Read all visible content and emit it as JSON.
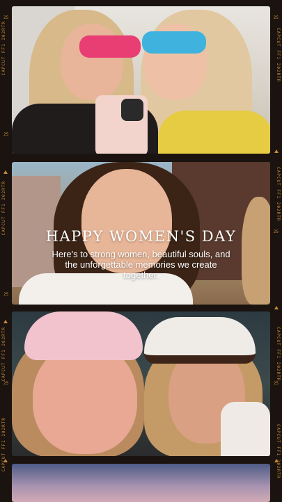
{
  "overlay": {
    "title": "HAPPY WOMEN'S DAY",
    "subtitle": "Here's to strong women, beautiful souls, and the unforgettable memories we create together."
  },
  "film_edge": {
    "left_text": "CAPCUT FF1 202RTR",
    "right_text": "CAPCUT FF1 202RTR",
    "frame_number": "25"
  },
  "frames": [
    {
      "label": "photo-frame-1"
    },
    {
      "label": "photo-frame-2"
    },
    {
      "label": "photo-frame-3"
    },
    {
      "label": "photo-frame-4"
    }
  ],
  "colors": {
    "film": "#1a130f",
    "sprocket_text": "#c98a3b",
    "overlay_text": "#ffffff"
  }
}
